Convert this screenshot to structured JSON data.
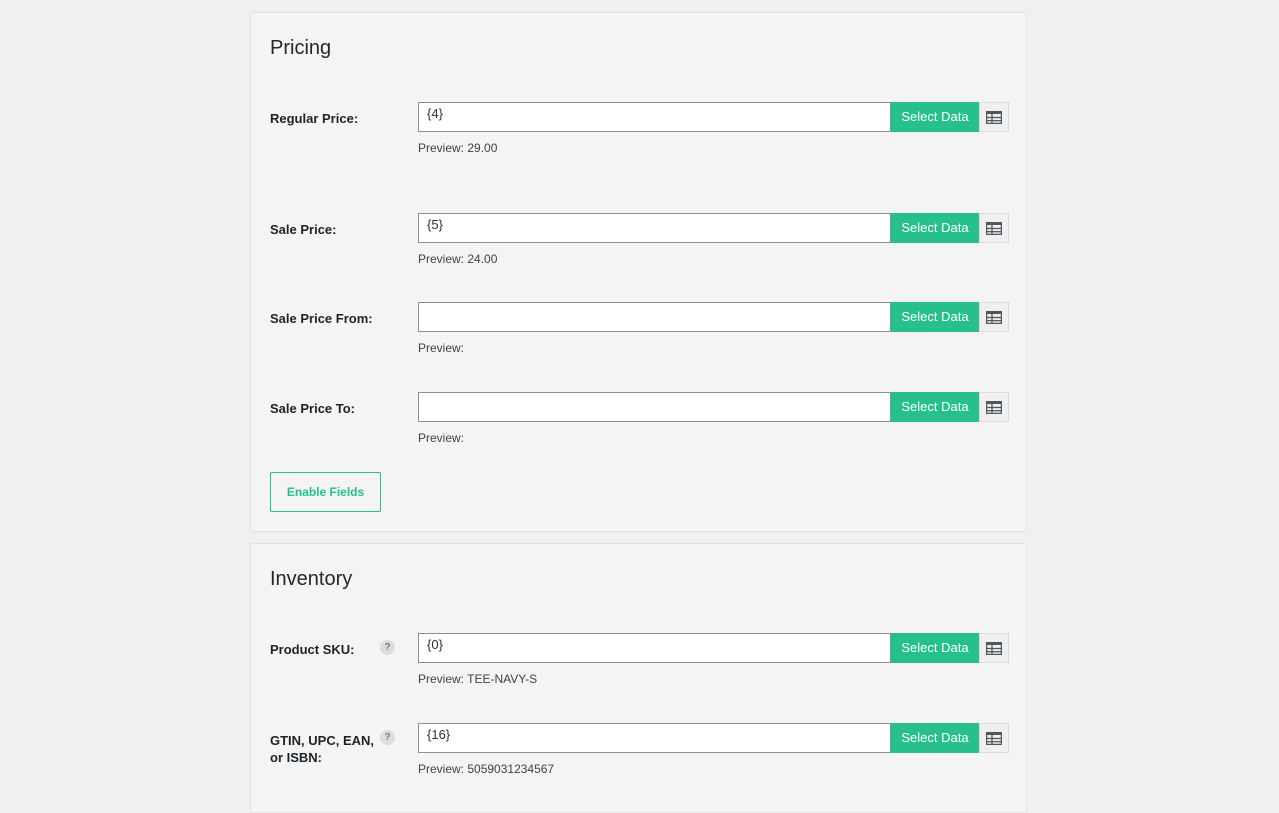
{
  "pricing": {
    "title": "Pricing",
    "fields": [
      {
        "label": "Regular Price:",
        "value": "{4}",
        "preview": "Preview: 29.00"
      },
      {
        "label": "Sale Price:",
        "value": "{5}",
        "preview": "Preview: 24.00"
      },
      {
        "label": "Sale Price From:",
        "value": "",
        "preview": "Preview:"
      },
      {
        "label": "Sale Price To:",
        "value": "",
        "preview": "Preview:"
      }
    ],
    "enable_label": "Enable Fields"
  },
  "inventory": {
    "title": "Inventory",
    "fields": [
      {
        "label": "Product SKU:",
        "value": "{0}",
        "preview": "Preview: TEE-NAVY-S",
        "help": "?"
      },
      {
        "label": "GTIN, UPC, EAN, or ISBN:",
        "value": "{16}",
        "preview": "Preview: 5059031234567",
        "help": "?"
      }
    ]
  },
  "select_data_label": "Select Data",
  "icons": {
    "table": "table-icon",
    "help": "help-icon"
  },
  "colors": {
    "accent": "#27c08a",
    "panel": "#f4f4f4",
    "background": "#f0f0f1"
  }
}
